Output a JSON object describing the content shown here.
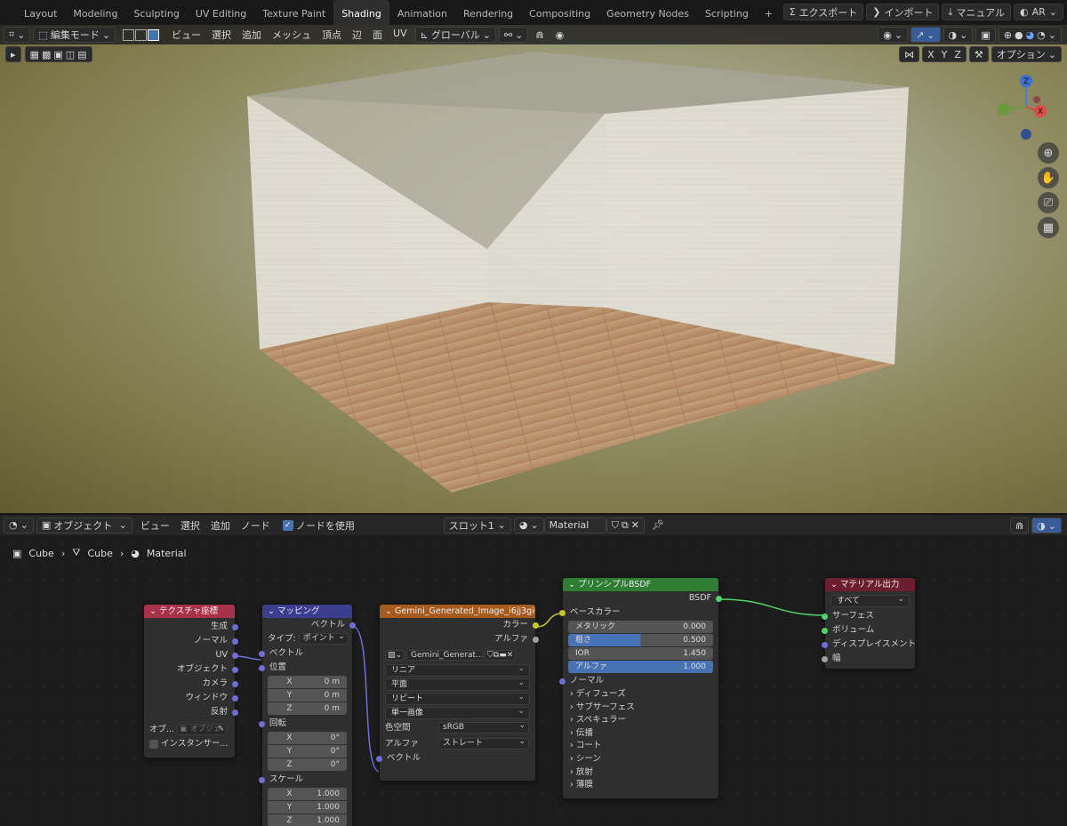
{
  "workspaces": [
    "Layout",
    "Modeling",
    "Sculpting",
    "UV Editing",
    "Texture Paint",
    "Shading",
    "Animation",
    "Rendering",
    "Compositing",
    "Geometry Nodes",
    "Scripting",
    "+"
  ],
  "active_workspace": "Shading",
  "top_right": {
    "export": "エクスポート",
    "import": "インポート",
    "manual": "マニュアル",
    "ar": "AR"
  },
  "viewport_header": {
    "mode": "編集モード",
    "menus": [
      "ビュー",
      "選択",
      "追加",
      "メッシュ",
      "頂点",
      "辺",
      "面",
      "UV"
    ],
    "transform": "グローバル"
  },
  "viewport_sub": {
    "axes": [
      "X",
      "Y",
      "Z"
    ],
    "options": "オプション"
  },
  "gizmo": {
    "z": "Z",
    "x": "X"
  },
  "node_header": {
    "object_mode": "オブジェクト",
    "menus": [
      "ビュー",
      "選択",
      "追加",
      "ノード"
    ],
    "use_nodes": "ノードを使用",
    "slot": "スロット1",
    "material": "Material"
  },
  "breadcrumb": {
    "obj": "Cube",
    "mesh": "Cube",
    "mat": "Material"
  },
  "nodes": {
    "texcoord": {
      "title": "テクスチャ座標",
      "outputs": [
        "生成",
        "ノーマル",
        "UV",
        "オブジェクト",
        "カメラ",
        "ウィンドウ",
        "反射"
      ],
      "obj_label": "オブ...",
      "obj_placeholder": "オブジェ",
      "instancer": "インスタンサー..."
    },
    "mapping": {
      "title": "マッピング",
      "out": "ベクトル",
      "type_label": "タイプ:",
      "type_value": "ポイント",
      "vector": "ベクトル",
      "location": "位置",
      "rotation": "回転",
      "scale": "スケール",
      "loc": [
        [
          "X",
          "0 m"
        ],
        [
          "Y",
          "0 m"
        ],
        [
          "Z",
          "0 m"
        ]
      ],
      "rot": [
        [
          "X",
          "0°"
        ],
        [
          "Y",
          "0°"
        ],
        [
          "Z",
          "0°"
        ]
      ],
      "scl": [
        [
          "X",
          "1.000"
        ],
        [
          "Y",
          "1.000"
        ],
        [
          "Z",
          "1.000"
        ]
      ]
    },
    "image": {
      "title": "Gemini_Generated_Image_i6jj3gi6jj3g...",
      "color": "カラー",
      "alpha": "アルファ",
      "file": "Gemini_Generat...",
      "interp": "リニア",
      "proj": "平面",
      "ext": "リピート",
      "src": "単一画像",
      "cs_label": "色空間",
      "cs_value": "sRGB",
      "alpha_label": "アルファ",
      "alpha_value": "ストレート",
      "vector": "ベクトル"
    },
    "bsdf": {
      "title": "プリンシプルBSDF",
      "out": "BSDF",
      "base": "ベースカラー",
      "metal": "メタリック",
      "metal_v": "0.000",
      "rough": "粗さ",
      "rough_v": "0.500",
      "ior": "IOR",
      "ior_v": "1.450",
      "alpha": "アルファ",
      "alpha_v": "1.000",
      "normal": "ノーマル",
      "panels": [
        "ディフューズ",
        "サブサーフェス",
        "スペキュラー",
        "伝播",
        "コート",
        "シーン",
        "放射",
        "薄膜"
      ]
    },
    "output": {
      "title": "マテリアル出力",
      "target": "すべて",
      "inputs": [
        "サーフェス",
        "ボリューム",
        "ディスプレイスメント",
        "幅"
      ]
    }
  },
  "colors": {
    "texcoord": "#a8324a",
    "mapping": "#3b3d8f",
    "image": "#a65a1c",
    "bsdf": "#2e7d32",
    "output": "#6b1f2e"
  }
}
